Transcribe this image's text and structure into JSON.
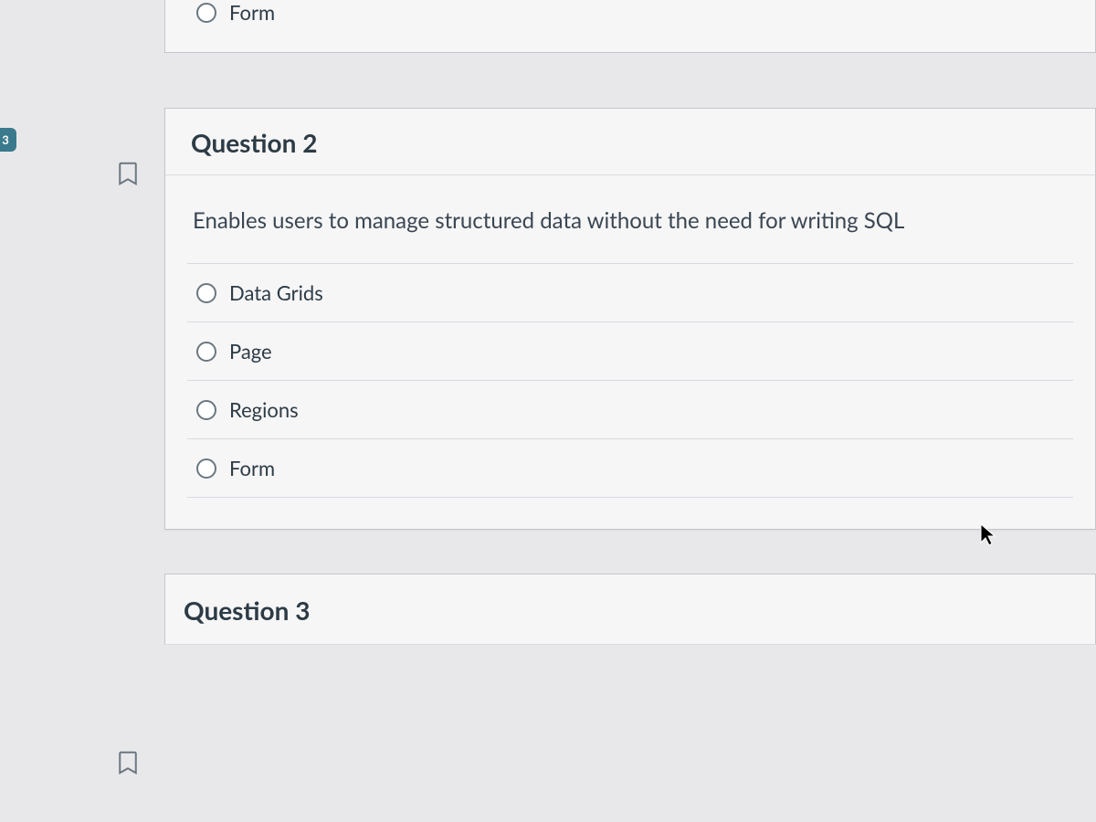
{
  "sidebar_badge": "3",
  "question1_fragment": {
    "last_option": "Form"
  },
  "question2": {
    "title": "Question 2",
    "prompt": "Enables users to manage structured data without the need for writing SQL",
    "options": [
      "Data Grids",
      "Page",
      "Regions",
      "Form"
    ]
  },
  "question3": {
    "title": "Question 3"
  }
}
